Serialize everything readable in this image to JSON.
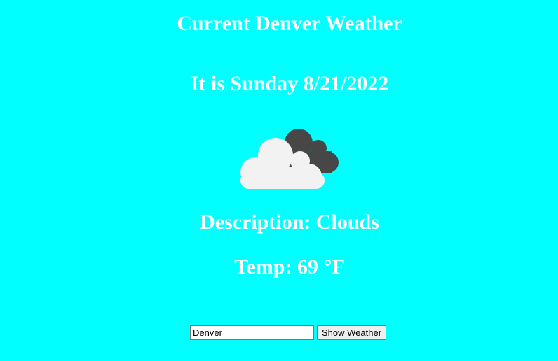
{
  "header": {
    "title": "Current Denver Weather",
    "date_line": "It is Sunday 8/21/2022"
  },
  "weather": {
    "icon": "broken-clouds-icon",
    "description_line": "Description: Clouds",
    "temp_line": "Temp: 69 °F"
  },
  "colors": {
    "background": "#00ffff",
    "text": "#ffffff",
    "cloud_front": "#f2f2f2",
    "cloud_back": "#474747"
  },
  "form": {
    "city_value": "Denver",
    "button_label": "Show Weather"
  }
}
